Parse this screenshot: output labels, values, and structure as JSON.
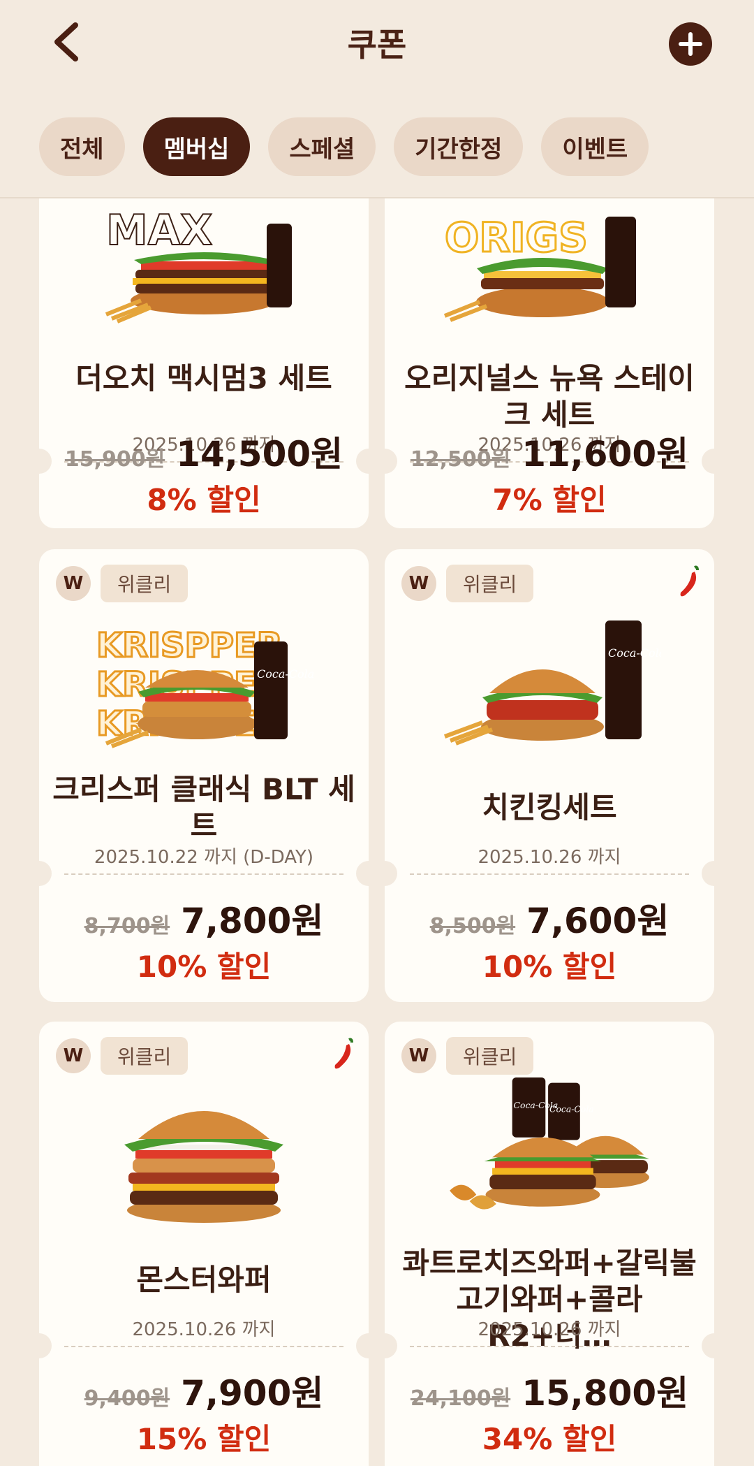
{
  "header": {
    "title": "쿠폰",
    "back_icon": "chevron-left-icon",
    "add_icon": "plus-icon"
  },
  "tabs": [
    {
      "label": "전체",
      "active": false
    },
    {
      "label": "멤버십",
      "active": true
    },
    {
      "label": "스페셜",
      "active": false
    },
    {
      "label": "기간한정",
      "active": false
    },
    {
      "label": "이벤트",
      "active": false
    }
  ],
  "coupons": [
    {
      "name": "더오치 맥시멈3 세트",
      "expiry": "2025.10.26 까지",
      "original_price": "15,900원",
      "price": "14,500원",
      "discount": "8% 할인"
    },
    {
      "name": "오리지널스 뉴욕 스테이크 세트",
      "expiry": "2025.10.26 까지",
      "original_price": "12,500원",
      "price": "11,600원",
      "discount": "7% 할인"
    },
    {
      "name": "크리스퍼 클래식 BLT 세트",
      "badge": "W",
      "tag": "위클리",
      "spicy": false,
      "expiry": "2025.10.22 까지  (D-DAY)",
      "original_price": "8,700원",
      "price": "7,800원",
      "discount": "10% 할인",
      "image_text": "KRISPPER"
    },
    {
      "name": "치킨킹세트",
      "badge": "W",
      "tag": "위클리",
      "spicy": true,
      "expiry": "2025.10.26 까지",
      "original_price": "8,500원",
      "price": "7,600원",
      "discount": "10% 할인"
    },
    {
      "name": "몬스터와퍼",
      "badge": "W",
      "tag": "위클리",
      "spicy": true,
      "expiry": "2025.10.26 까지",
      "original_price": "9,400원",
      "price": "7,900원",
      "discount": "15% 할인"
    },
    {
      "name": "콰트로치즈와퍼+갈릭불고기와퍼+콜라R2+너…",
      "badge": "W",
      "tag": "위클리",
      "spicy": false,
      "expiry": "2025.10.26 까지",
      "original_price": "24,100원",
      "price": "15,800원",
      "discount": "34% 할인"
    }
  ],
  "colors": {
    "background": "#f3eadf",
    "brand_dark": "#4a1f12",
    "discount_red": "#d12c10",
    "card": "#fffdf8"
  }
}
